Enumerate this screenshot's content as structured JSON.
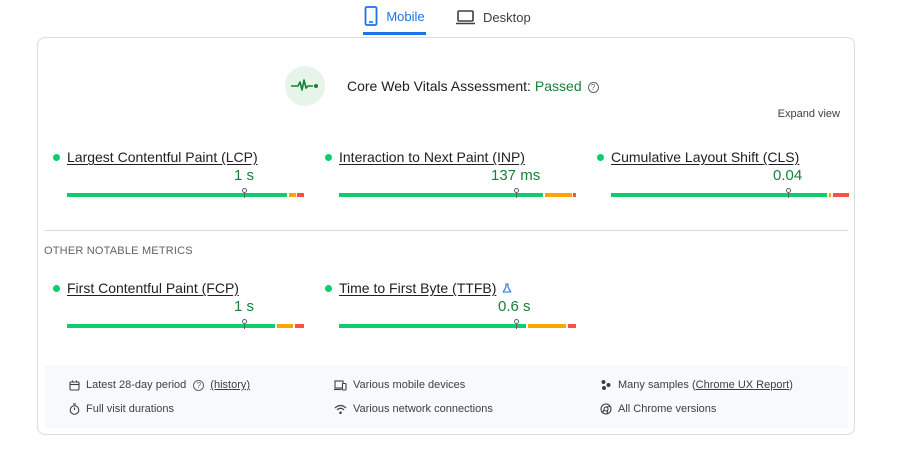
{
  "tabs": [
    {
      "label": "Mobile",
      "icon": "smartphone-icon",
      "active": true
    },
    {
      "label": "Desktop",
      "icon": "laptop-icon",
      "active": false
    }
  ],
  "assessment": {
    "label": "Core Web Vitals Assessment:",
    "status": "Passed",
    "help_glyph": "?"
  },
  "expand_view_label": "Expand view",
  "core_metrics": [
    {
      "name": "Largest Contentful Paint (LCP)",
      "value": "1 s",
      "status": "good"
    },
    {
      "name": "Interaction to Next Paint (INP)",
      "value": "137 ms",
      "status": "good"
    },
    {
      "name": "Cumulative Layout Shift (CLS)",
      "value": "0.04",
      "status": "good"
    }
  ],
  "other_title": "OTHER NOTABLE METRICS",
  "other_metrics": [
    {
      "name": "First Contentful Paint (FCP)",
      "value": "1 s",
      "status": "good"
    },
    {
      "name": "Time to First Byte (TTFB)",
      "value": "0.6 s",
      "status": "good",
      "experimental_icon": "flask-icon"
    }
  ],
  "info": {
    "period_label": "Latest 28-day period",
    "period_help": "?",
    "history_link": "(history)",
    "devices": "Various mobile devices",
    "samples_prefix": "Many samples (",
    "samples_link": "Chrome UX Report",
    "samples_suffix": ")",
    "durations": "Full visit durations",
    "network": "Various network connections",
    "chrome_versions": "All Chrome versions"
  },
  "colors": {
    "accent": "#1a73e8",
    "pass": "#188038",
    "good": "#0cce6b",
    "needs_improvement": "#ffa400",
    "poor": "#ff4e42"
  }
}
